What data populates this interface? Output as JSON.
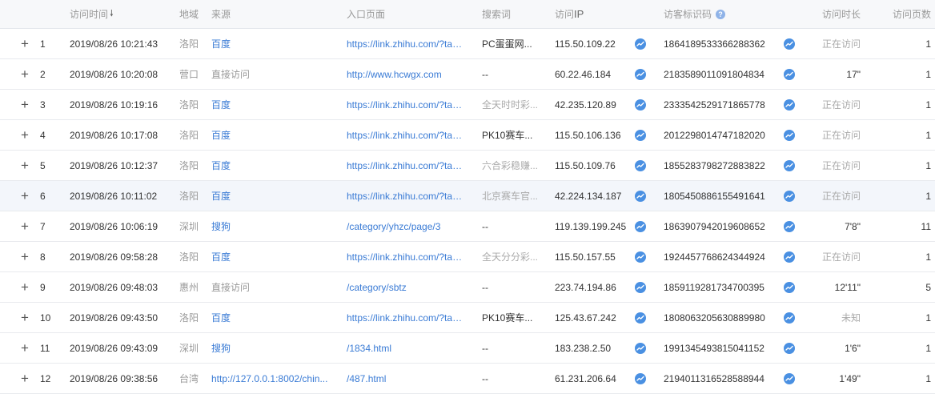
{
  "header": {
    "time": "访问时间",
    "time_sort_icon": "sort-down-arrow",
    "region": "地域",
    "source": "来源",
    "entry": "入口页面",
    "keyword": "搜索词",
    "ip_prefix": "访问",
    "ip_suffix": "IP",
    "visitor_id": "访客标识码",
    "help_icon": "?",
    "duration": "访问时长",
    "pages": "访问页数"
  },
  "icons": {
    "expand": "+",
    "trend": "trend-line-icon"
  },
  "colors": {
    "link": "#3a7bd5",
    "trend_icon": "#4a90e2",
    "muted": "#999999"
  },
  "rows": [
    {
      "idx": "1",
      "time": "2019/08/26 10:21:43",
      "region": "洛阳",
      "source": "百度",
      "entry": "https://link.zhihu.com/?target=...",
      "keyword": "PC蛋蛋网...",
      "ip": "115.50.109.22",
      "vid": "1864189533366288362",
      "dur": "正在访问",
      "pages": "1"
    },
    {
      "idx": "2",
      "time": "2019/08/26 10:20:08",
      "region": "营口",
      "source": "直接访问",
      "entry": "http://www.hcwgx.com",
      "keyword": "--",
      "ip": "60.22.46.184",
      "vid": "2183589011091804834",
      "dur": "17\"",
      "pages": "1"
    },
    {
      "idx": "3",
      "time": "2019/08/26 10:19:16",
      "region": "洛阳",
      "source": "百度",
      "entry": "https://link.zhihu.com/?target=...",
      "keyword": "全天时时彩...",
      "ip": "42.235.120.89",
      "vid": "2333542529171865778",
      "dur": "正在访问",
      "pages": "1"
    },
    {
      "idx": "4",
      "time": "2019/08/26 10:17:08",
      "region": "洛阳",
      "source": "百度",
      "entry": "https://link.zhihu.com/?target=...",
      "keyword": "PK10赛车...",
      "ip": "115.50.106.136",
      "vid": "2012298014747182020",
      "dur": "正在访问",
      "pages": "1"
    },
    {
      "idx": "5",
      "time": "2019/08/26 10:12:37",
      "region": "洛阳",
      "source": "百度",
      "entry": "https://link.zhihu.com/?target=...",
      "keyword": "六合彩稳赚...",
      "ip": "115.50.109.76",
      "vid": "1855283798272883822",
      "dur": "正在访问",
      "pages": "1"
    },
    {
      "idx": "6",
      "time": "2019/08/26 10:11:02",
      "region": "洛阳",
      "source": "百度",
      "entry": "https://link.zhihu.com/?target=...",
      "keyword": "北京赛车官...",
      "ip": "42.224.134.187",
      "vid": "1805450886155491641",
      "dur": "正在访问",
      "pages": "1"
    },
    {
      "idx": "7",
      "time": "2019/08/26 10:06:19",
      "region": "深圳",
      "source": "搜狗",
      "entry": "/category/yhzc/page/3",
      "keyword": "--",
      "ip": "119.139.199.245",
      "vid": "1863907942019608652",
      "dur": "7'8\"",
      "pages": "11"
    },
    {
      "idx": "8",
      "time": "2019/08/26 09:58:28",
      "region": "洛阳",
      "source": "百度",
      "entry": "https://link.zhihu.com/?target=...",
      "keyword": "全天分分彩...",
      "ip": "115.50.157.55",
      "vid": "1924457768624344924",
      "dur": "正在访问",
      "pages": "1"
    },
    {
      "idx": "9",
      "time": "2019/08/26 09:48:03",
      "region": "惠州",
      "source": "直接访问",
      "entry": "/category/sbtz",
      "keyword": "--",
      "ip": "223.74.194.86",
      "vid": "1859119281734700395",
      "dur": "12'11\"",
      "pages": "5"
    },
    {
      "idx": "10",
      "time": "2019/08/26 09:43:50",
      "region": "洛阳",
      "source": "百度",
      "entry": "https://link.zhihu.com/?target=...",
      "keyword": "PK10赛车...",
      "ip": "125.43.67.242",
      "vid": "1808063205630889980",
      "dur": "未知",
      "pages": "1"
    },
    {
      "idx": "11",
      "time": "2019/08/26 09:43:09",
      "region": "深圳",
      "source": "搜狗",
      "entry": "/1834.html",
      "keyword": "--",
      "ip": "183.238.2.50",
      "vid": "1991345493815041152",
      "dur": "1'6\"",
      "pages": "1"
    },
    {
      "idx": "12",
      "time": "2019/08/26 09:38:56",
      "region": "台湾",
      "source": "http://127.0.0.1:8002/chin...",
      "entry": "/487.html",
      "keyword": "--",
      "ip": "61.231.206.64",
      "vid": "2194011316528588944",
      "dur": "1'49\"",
      "pages": "1"
    }
  ]
}
